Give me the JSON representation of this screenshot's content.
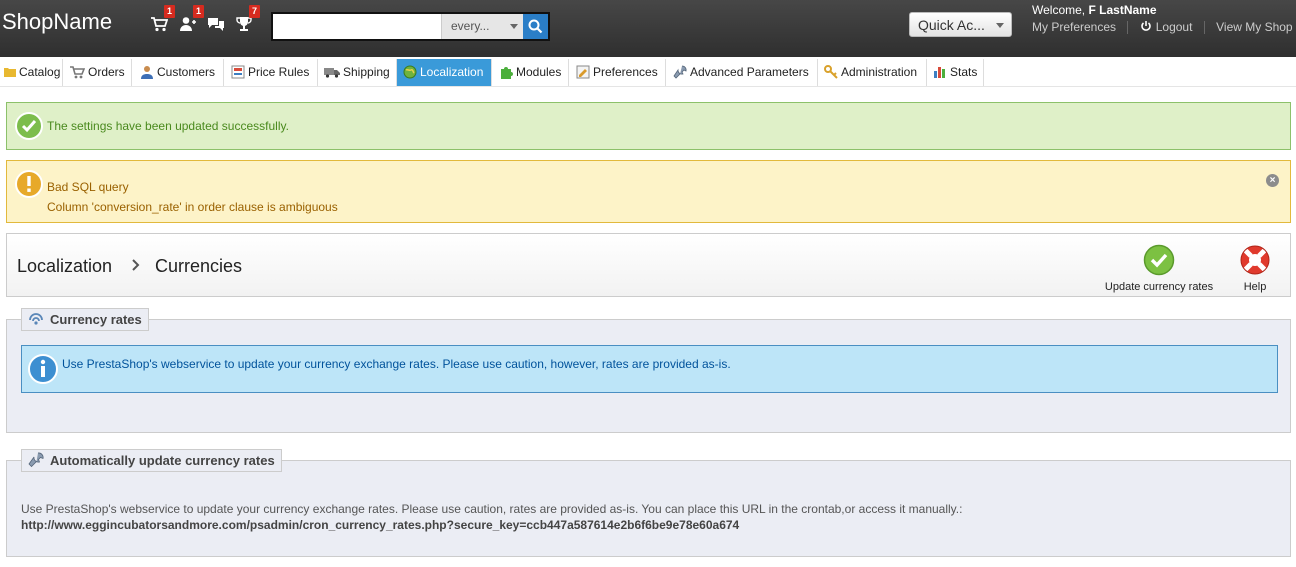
{
  "header": {
    "shop_name": "ShopName",
    "notifications": [
      {
        "name": "orders",
        "count": "1"
      },
      {
        "name": "customers",
        "count": "1"
      },
      {
        "name": "messages",
        "count": ""
      },
      {
        "name": "achievements",
        "count": "7"
      }
    ],
    "search": {
      "value": "",
      "scope": "every..."
    },
    "quick_access": "Quick Ac...",
    "welcome_prefix": "Welcome,",
    "user_name": "F LastName",
    "my_preferences": "My Preferences",
    "logout": "Logout",
    "view_shop": "View My Shop",
    "colors": {
      "bg": "#3b3b3b",
      "badge": "#d62b1f",
      "search_btn": "#2a7ec7"
    }
  },
  "tabs": [
    {
      "label": "Catalog",
      "icon": "folder-icon",
      "active": false
    },
    {
      "label": "Orders",
      "icon": "cart-icon",
      "active": false
    },
    {
      "label": "Customers",
      "icon": "user-icon",
      "active": false
    },
    {
      "label": "Price Rules",
      "icon": "price-tag-icon",
      "active": false
    },
    {
      "label": "Shipping",
      "icon": "truck-icon",
      "active": false
    },
    {
      "label": "Localization",
      "icon": "globe-icon",
      "active": true
    },
    {
      "label": "Modules",
      "icon": "puzzle-icon",
      "active": false
    },
    {
      "label": "Preferences",
      "icon": "preferences-icon",
      "active": false
    },
    {
      "label": "Advanced Parameters",
      "icon": "wrench-icon",
      "active": false
    },
    {
      "label": "Administration",
      "icon": "key-icon",
      "active": false
    },
    {
      "label": "Stats",
      "icon": "chart-icon",
      "active": false
    }
  ],
  "alerts": {
    "success": "The settings have been updated successfully.",
    "warning_title": "Bad SQL query",
    "warning_detail": "Column 'conversion_rate' in order clause is ambiguous"
  },
  "breadcrumb": {
    "parent": "Localization",
    "current": "Currencies"
  },
  "toolbar": {
    "update_rates": "Update currency rates",
    "help": "Help"
  },
  "currency_rates": {
    "legend": "Currency rates",
    "info": "Use PrestaShop's webservice to update your currency exchange rates. Please use caution, however, rates are provided as-is."
  },
  "auto_update": {
    "legend": "Automatically update currency rates",
    "text": "Use PrestaShop's webservice to update your currency exchange rates. Please use caution, rates are provided as-is. You can place this URL in the crontab,or access it manually.:",
    "url": "http://www.eggincubatorsandmore.com/psadmin/cron_currency_rates.php?secure_key=ccb447a587614e2b6f6be9e78e60a674"
  }
}
